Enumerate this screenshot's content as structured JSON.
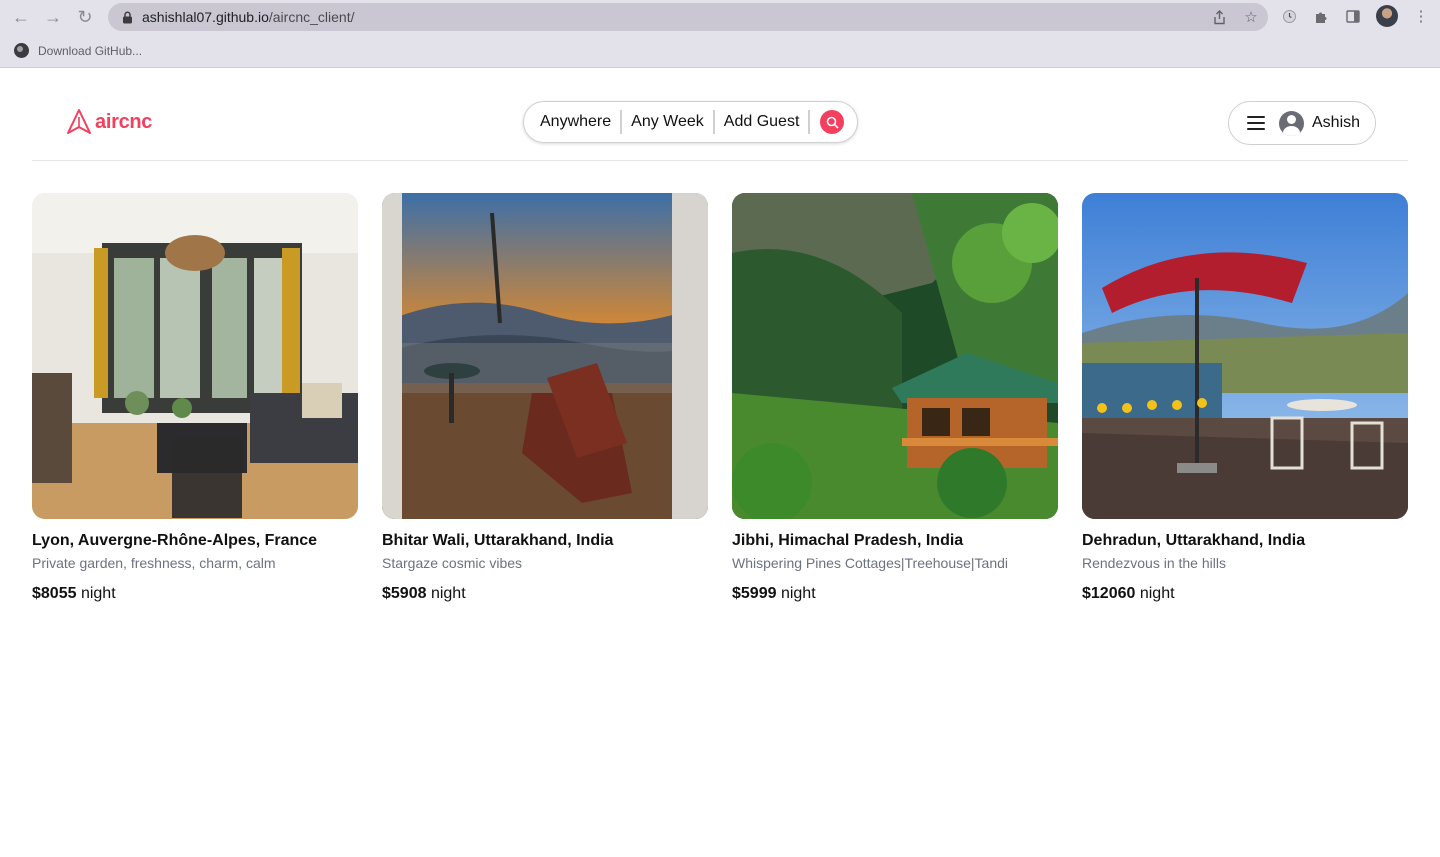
{
  "browser": {
    "url_host": "ashishlal07.github.io",
    "url_path": "/aircnc_client/",
    "bookmark_label": "Download GitHub..."
  },
  "app": {
    "logo_text": "aircnc",
    "search": {
      "anywhere": "Anywhere",
      "any_week": "Any Week",
      "add_guest": "Add Guest"
    },
    "user_name": "Ashish",
    "accent_color": "#f43f5e"
  },
  "listings": [
    {
      "title": "Lyon, Auvergne-Rhône-Alpes, France",
      "subtitle": "Private garden, freshness, charm, calm",
      "price": "$8055",
      "unit": " night"
    },
    {
      "title": "Bhitar Wali, Uttarakhand, India",
      "subtitle": "Stargaze cosmic vibes",
      "price": "$5908",
      "unit": " night"
    },
    {
      "title": "Jibhi, Himachal Pradesh, India",
      "subtitle": "Whispering Pines Cottages|Treehouse|Tandi",
      "price": "$5999",
      "unit": " night"
    },
    {
      "title": "Dehradun, Uttarakhand, India",
      "subtitle": "Rendezvous in the hills",
      "price": "$12060",
      "unit": " night"
    }
  ]
}
